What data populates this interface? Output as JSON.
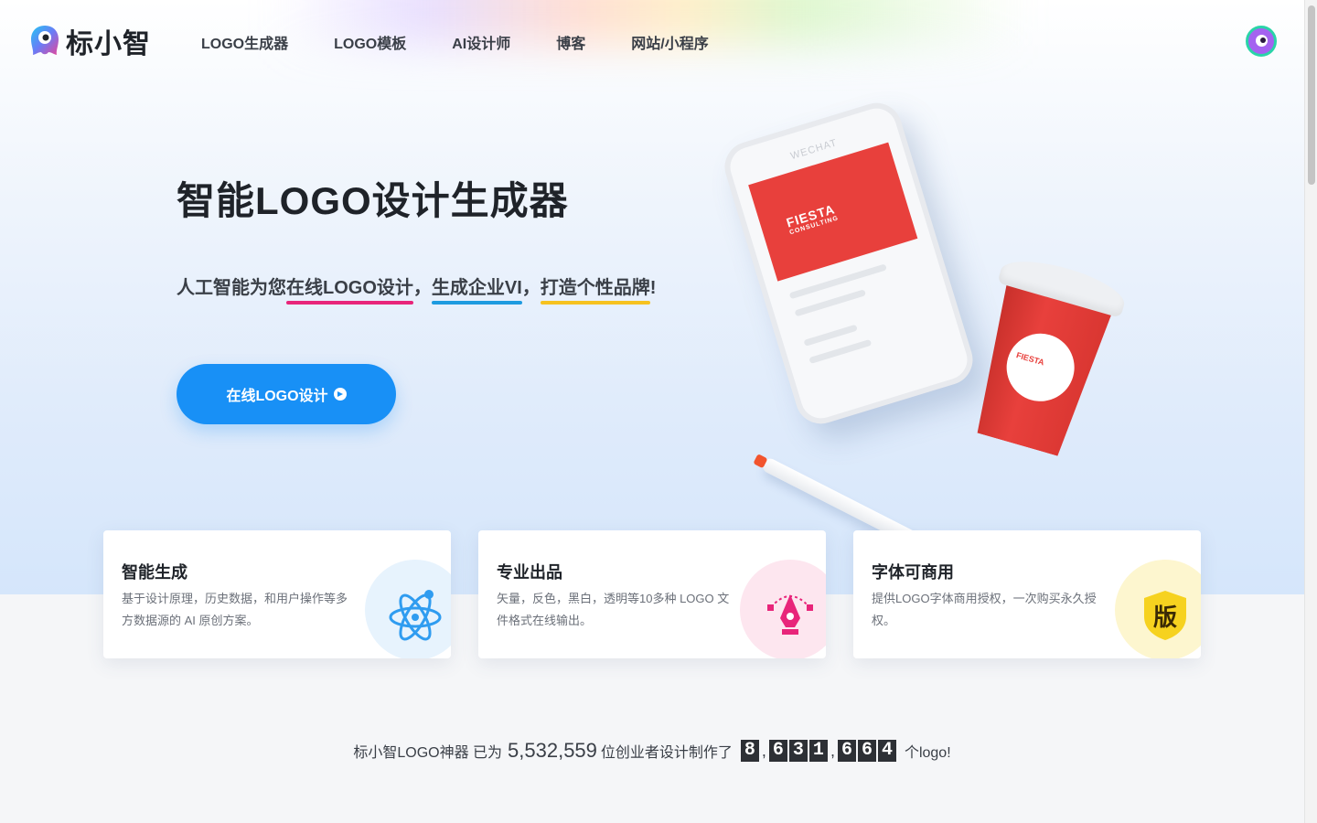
{
  "brand": {
    "name": "标小智"
  },
  "nav": {
    "items": [
      {
        "label": "LOGO生成器"
      },
      {
        "label": "LOGO模板"
      },
      {
        "label": "AI设计师"
      },
      {
        "label": "博客"
      },
      {
        "label": "网站/小程序"
      }
    ]
  },
  "hero": {
    "title": "智能LOGO设计生成器",
    "subtitle_prefix": "人工智能为您",
    "subtitle_hl1": "在线LOGO设计",
    "subtitle_comma1": "，",
    "subtitle_hl2": "生成企业VI",
    "subtitle_comma2": "，",
    "subtitle_hl3": "打造个性品牌",
    "subtitle_end": "!",
    "cta_label": "在线LOGO设计"
  },
  "illustration": {
    "phone_app": "WECHAT",
    "brand_name": "FIESTA",
    "brand_sub": "CONSULTING"
  },
  "features": [
    {
      "title": "智能生成",
      "desc": "基于设计原理，历史数据，和用户操作等多方数据源的 AI 原创方案。",
      "icon": "atom-icon"
    },
    {
      "title": "专业出品",
      "desc": "矢量，反色，黑白，透明等10多种 LOGO 文件格式在线输出。",
      "icon": "pen-tool-icon"
    },
    {
      "title": "字体可商用",
      "desc": "提供LOGO字体商用授权，一次购买永久授权。",
      "icon": "copyright-shield-icon",
      "badge": "版"
    }
  ],
  "stats": {
    "prefix": "标小智LOGO神器 已为",
    "users": "5,532,559",
    "middle": "位创业者设计制作了",
    "logo_count_groups": [
      "8",
      "631",
      "664"
    ],
    "suffix": "个logo!"
  },
  "colors": {
    "accent": "#1890f6",
    "pink": "#e8257a",
    "blue": "#1e9be0",
    "yellow": "#f6c21f",
    "brand_red": "#e8403c"
  }
}
